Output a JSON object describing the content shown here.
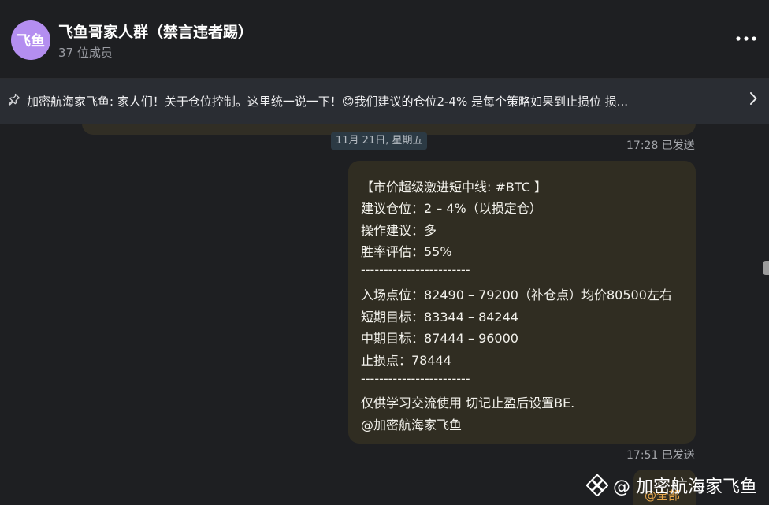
{
  "header": {
    "avatar_text": "飞鱼",
    "avatar_color": "#b48ef0",
    "title": "飞鱼哥家人群（禁言违者踢）",
    "members": "37 位成员",
    "more_icon": "more-dots-icon"
  },
  "pinned": {
    "icon": "pin-icon",
    "text": "加密航海家飞鱼: 家人们！关于仓位控制。这里统一说一下！😊我们建议的仓位2-4% 是每个策略如果到止损位 损...",
    "arrow_icon": "chevron-right-icon"
  },
  "prev_message": {
    "time_status": "17:28 已发送"
  },
  "date_separator": "11月 21日, 星期五",
  "message": {
    "lines": [
      "【市价超级激进短中线: #BTC 】",
      "建议仓位：2 – 4%（以损定仓）",
      "操作建议：多",
      "胜率评估：55%",
      "------------------------",
      "入场点位：82490 – 79200（补仓点）均价80500左右",
      "短期目标：83344 – 84244",
      "中期目标：87444 – 96000",
      "止损点：78444",
      "------------------------",
      "仅供学习交流使用 切记止盈后设置BE.",
      " @加密航海家飞鱼"
    ],
    "time_status": "17:51 已发送"
  },
  "next_message": {
    "mention": "@全部"
  },
  "watermark": {
    "icon": "binance-logo-icon",
    "text": "@ 加密航海家飞鱼"
  },
  "colors": {
    "background": "#1e1f22",
    "bubble": "#302d22",
    "pinned_bar": "#2a2d33",
    "mention": "#e6a64a"
  }
}
